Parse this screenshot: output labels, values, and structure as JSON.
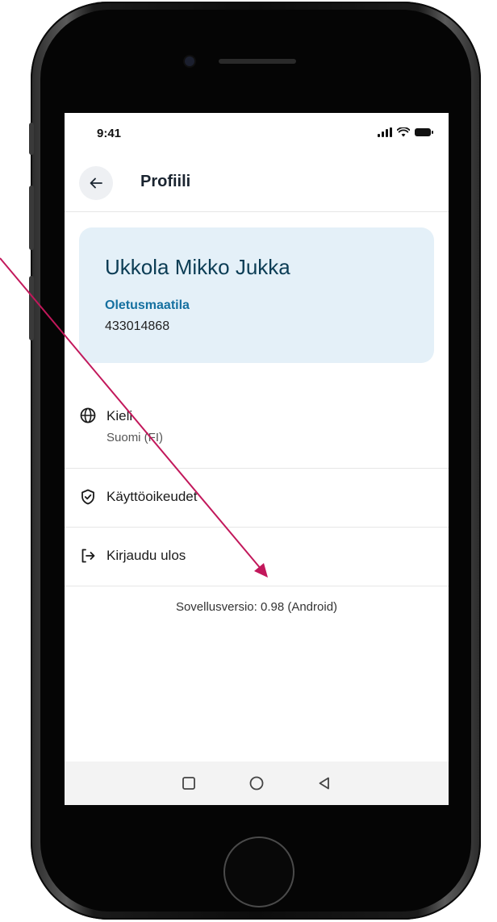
{
  "status_bar": {
    "time": "9:41",
    "icons": [
      "signal-icon",
      "wifi-icon",
      "battery-icon"
    ]
  },
  "header": {
    "back_icon": "arrow-left-icon",
    "title": "Profiili"
  },
  "profile": {
    "name": "Ukkola Mikko Jukka",
    "farm_label": "Oletusmaatila",
    "farm_id": "433014868"
  },
  "menu": [
    {
      "icon": "globe-icon",
      "label": "Kieli",
      "sublabel": "Suomi (FI)"
    },
    {
      "icon": "shield-check-icon",
      "label": "Käyttöoikeudet"
    },
    {
      "icon": "logout-icon",
      "label": "Kirjaudu ulos"
    }
  ],
  "version_text": "Sovellusversio: 0.98 (Android)",
  "nav_bar": {
    "buttons": [
      "square-icon",
      "circle-icon",
      "triangle-back-icon"
    ]
  },
  "colors": {
    "card_background": "#e4f0f8",
    "name_color": "#0c3d55",
    "farm_label_color": "#1570a0",
    "annotation_arrow": "#c2185b"
  }
}
